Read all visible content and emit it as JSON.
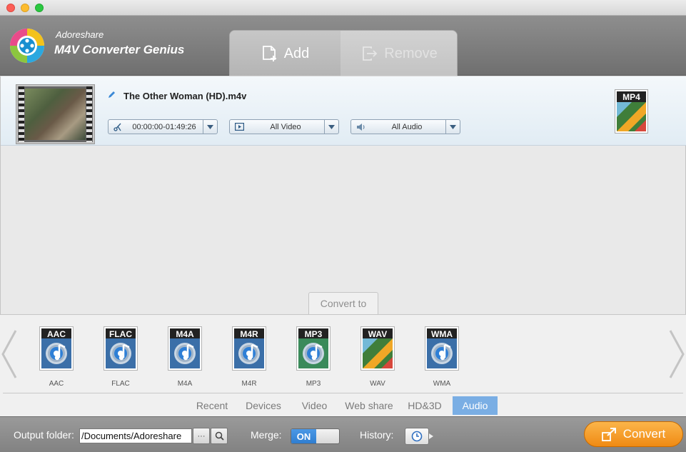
{
  "app": {
    "brand_small": "Adoreshare",
    "brand_big": "M4V Converter Genius"
  },
  "header": {
    "add_label": "Add",
    "remove_label": "Remove"
  },
  "file": {
    "name": "The Other Woman (HD).m4v",
    "trim_range": "00:00:00-01:49:26",
    "video_track": "All Video",
    "audio_track": "All Audio",
    "output_format": "MP4"
  },
  "convert_to_label": "Convert to",
  "formats": [
    {
      "badge": "AAC",
      "label": "AAC",
      "kind": "audio"
    },
    {
      "badge": "FLAC",
      "label": "FLAC",
      "kind": "audio"
    },
    {
      "badge": "M4A",
      "label": "M4A",
      "kind": "audio"
    },
    {
      "badge": "M4R",
      "label": "M4R",
      "kind": "audio"
    },
    {
      "badge": "MP3",
      "label": "MP3",
      "kind": "audio-green"
    },
    {
      "badge": "WAV",
      "label": "WAV",
      "kind": "wave"
    },
    {
      "badge": "WMA",
      "label": "WMA",
      "kind": "audio"
    }
  ],
  "categories": [
    {
      "label": "Recent",
      "active": false
    },
    {
      "label": "Devices",
      "active": false
    },
    {
      "label": "Video",
      "active": false
    },
    {
      "label": "Web share",
      "active": false
    },
    {
      "label": "HD&3D",
      "active": false
    },
    {
      "label": "Audio",
      "active": true
    }
  ],
  "bottom": {
    "output_folder_label": "Output folder:",
    "output_folder_value": "/Documents/Adoreshare",
    "browse_label": "···",
    "merge_label": "Merge:",
    "merge_state": "ON",
    "history_label": "History:",
    "convert_label": "Convert"
  },
  "colors": {
    "accent_blue": "#7aaee4",
    "convert_orange": "#f08a13",
    "toggle_blue": "#2f7ed0"
  }
}
